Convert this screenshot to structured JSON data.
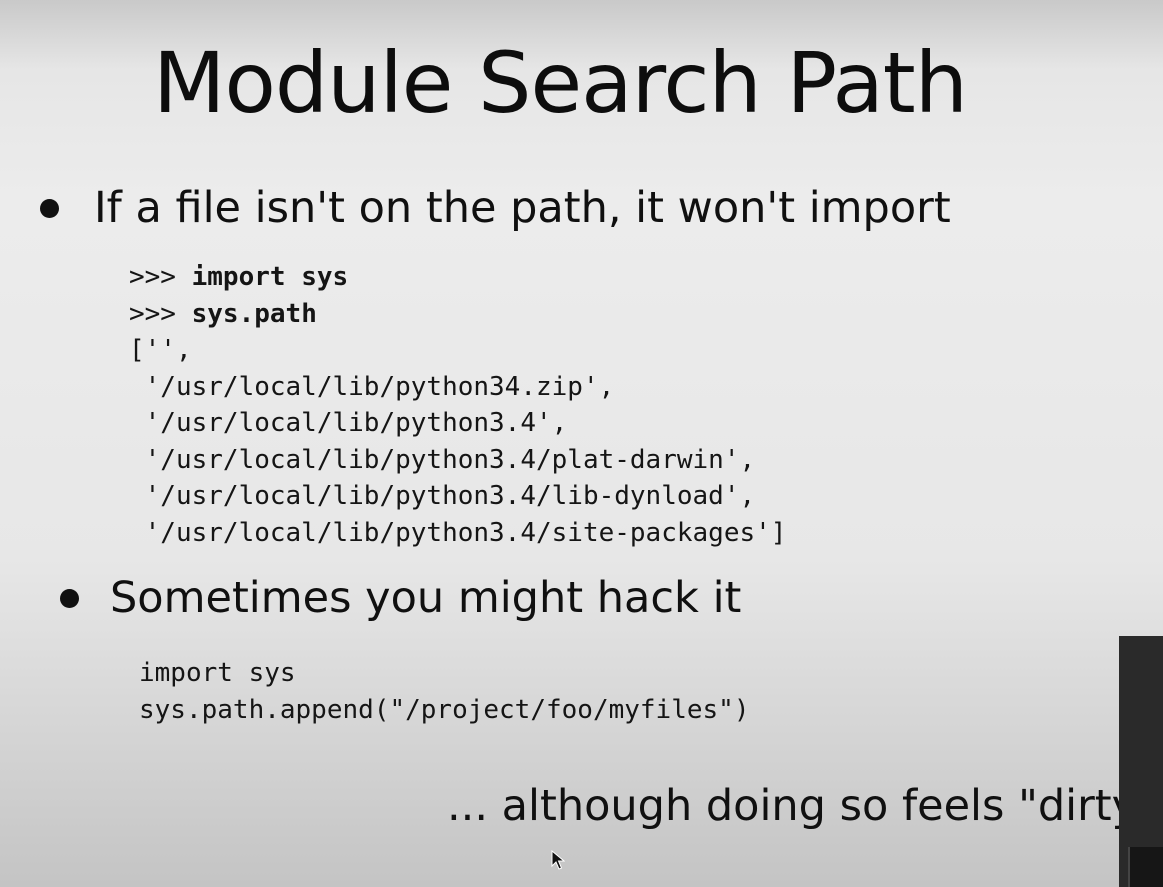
{
  "slide": {
    "title": "Module Search Path",
    "bullet1": "If a file isn't on the path, it won't import",
    "code1": {
      "prompt": ">>>",
      "cmd1": "import sys",
      "cmd2": "sys.path",
      "output": [
        "['',",
        " '/usr/local/lib/python34.zip',",
        " '/usr/local/lib/python3.4',",
        " '/usr/local/lib/python3.4/plat-darwin',",
        " '/usr/local/lib/python3.4/lib-dynload',",
        " '/usr/local/lib/python3.4/site-packages']"
      ]
    },
    "bullet2": "Sometimes you might hack it",
    "code2": [
      "import sys",
      "sys.path.append(\"/project/foo/myfiles\")"
    ],
    "note": "... although doing so feels \"dirty"
  }
}
